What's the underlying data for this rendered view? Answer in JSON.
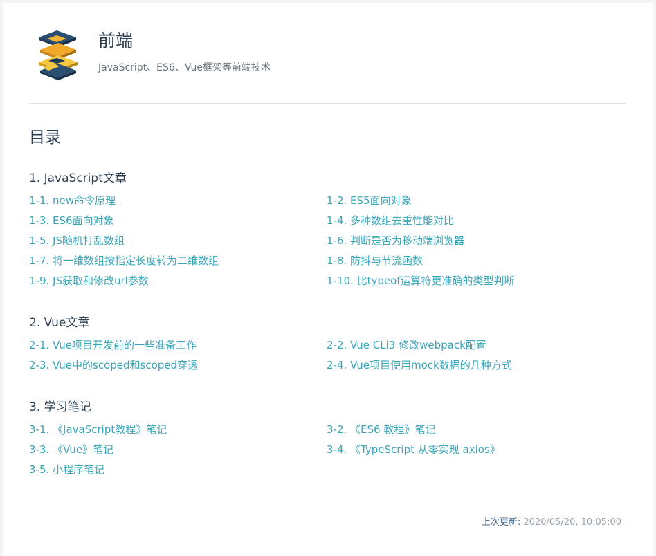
{
  "header": {
    "title": "前端",
    "subtitle": "JavaScript、ES6、Vue框架等前端技术"
  },
  "toc": {
    "title": "目录",
    "sections": [
      {
        "title": "1. JavaScript文章",
        "links": [
          "1-1. new命令原理",
          "1-2. ES5面向对象",
          "1-3. ES6面向对象",
          "1-4. 多种数组去重性能对比",
          "1-5. JS随机打乱数组",
          "1-6. 判断是否为移动端浏览器",
          "1-7. 将一维数组按指定长度转为二维数组",
          "1-8. 防抖与节流函数",
          "1-9. JS获取和修改url参数",
          "1-10. 比typeof运算符更准确的类型判断"
        ]
      },
      {
        "title": "2. Vue文章",
        "links": [
          "2-1. Vue项目开发前的一些准备工作",
          "2-2. Vue CLi3 修改webpack配置",
          "2-3. Vue中的scoped和scoped穿透",
          "2-4. Vue项目使用mock数据的几种方式"
        ]
      },
      {
        "title": "3. 学习笔记",
        "links": [
          "3-1. 《JavaScript教程》笔记",
          "3-2. 《ES6 教程》笔记",
          "3-3. 《Vue》笔记",
          "3-4. 《TypeScript 从零实现 axios》",
          "3-5. 小程序笔记"
        ]
      }
    ]
  },
  "footer": {
    "last_updated_label": "上次更新:",
    "last_updated_value": "2020/05/20, 10:05:00"
  },
  "colors": {
    "link": "#3aa6b9",
    "heading": "#2c3e50"
  }
}
